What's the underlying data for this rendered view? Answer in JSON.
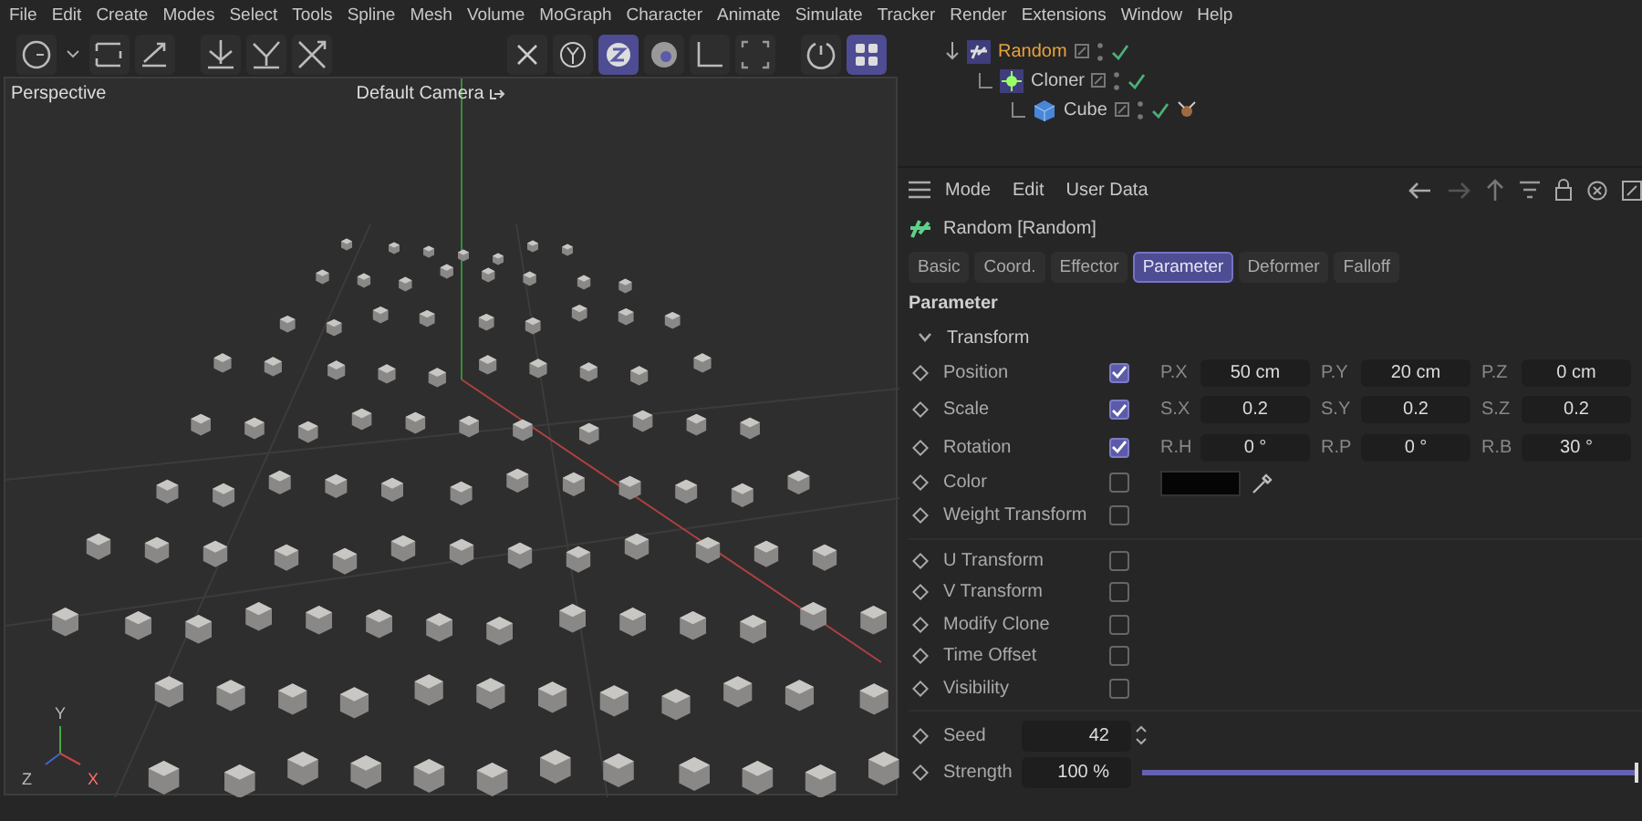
{
  "menu_bar": [
    "File",
    "Edit",
    "Create",
    "Modes",
    "Select",
    "Tools",
    "Spline",
    "Mesh",
    "Volume",
    "MoGraph",
    "Character",
    "Animate",
    "Simulate",
    "Tracker",
    "Render",
    "Extensions",
    "Window",
    "Help"
  ],
  "toolbar": {
    "axis_buttons": [
      {
        "selected": false
      },
      {
        "selected": false
      },
      {
        "selected": true
      }
    ]
  },
  "viewport": {
    "view_name": "Perspective",
    "camera": "Default Camera",
    "axis_labels": [
      "Y",
      "Z",
      "X"
    ]
  },
  "object_tree": [
    {
      "name": "Random",
      "selected": true,
      "enabled": true,
      "children": [
        {
          "name": "Cloner",
          "selected": false,
          "enabled": true,
          "children": [
            {
              "name": "Cube",
              "selected": false,
              "enabled": true
            }
          ]
        }
      ]
    }
  ],
  "attributes": {
    "menu": [
      "Mode",
      "Edit",
      "User Data"
    ],
    "title": "Random [Random]",
    "tabs": [
      {
        "label": "Basic",
        "selected": false
      },
      {
        "label": "Coord.",
        "selected": false
      },
      {
        "label": "Effector",
        "selected": false
      },
      {
        "label": "Parameter",
        "selected": true
      },
      {
        "label": "Deformer",
        "selected": false
      },
      {
        "label": "Falloff",
        "selected": false
      }
    ],
    "section": "Parameter",
    "group": {
      "label": "Transform",
      "expanded": true
    },
    "rows": [
      {
        "kind": "vector",
        "label": "Position",
        "checked": true,
        "fields": [
          {
            "label": "P.X",
            "value": "50 cm"
          },
          {
            "label": "P.Y",
            "value": "20 cm"
          },
          {
            "label": "P.Z",
            "value": "0 cm"
          }
        ]
      },
      {
        "kind": "vector",
        "label": "Scale",
        "checked": true,
        "fields": [
          {
            "label": "S.X",
            "value": "0.2"
          },
          {
            "label": "S.Y",
            "value": "0.2"
          },
          {
            "label": "S.Z",
            "value": "0.2"
          }
        ]
      },
      {
        "kind": "vector",
        "label": "Rotation",
        "checked": true,
        "fields": [
          {
            "label": "R.H",
            "value": "0 °"
          },
          {
            "label": "R.P",
            "value": "0 °"
          },
          {
            "label": "R.B",
            "value": "30 °"
          }
        ]
      },
      {
        "kind": "color",
        "label": "Color",
        "checked": false,
        "color": "#050505"
      },
      {
        "kind": "check",
        "label": "Weight Transform",
        "checked": false
      },
      {
        "kind": "divider"
      },
      {
        "kind": "check",
        "label": "U Transform",
        "checked": false
      },
      {
        "kind": "check",
        "label": "V Transform",
        "checked": false
      },
      {
        "kind": "check",
        "label": "Modify Clone",
        "checked": false
      },
      {
        "kind": "check",
        "label": "Time Offset",
        "checked": false
      },
      {
        "kind": "check",
        "label": "Visibility",
        "checked": false
      },
      {
        "kind": "divider"
      },
      {
        "kind": "number",
        "label": "Seed",
        "value": "42"
      },
      {
        "kind": "slider",
        "label": "Strength",
        "value": "100 %",
        "level": 1.0
      }
    ]
  }
}
